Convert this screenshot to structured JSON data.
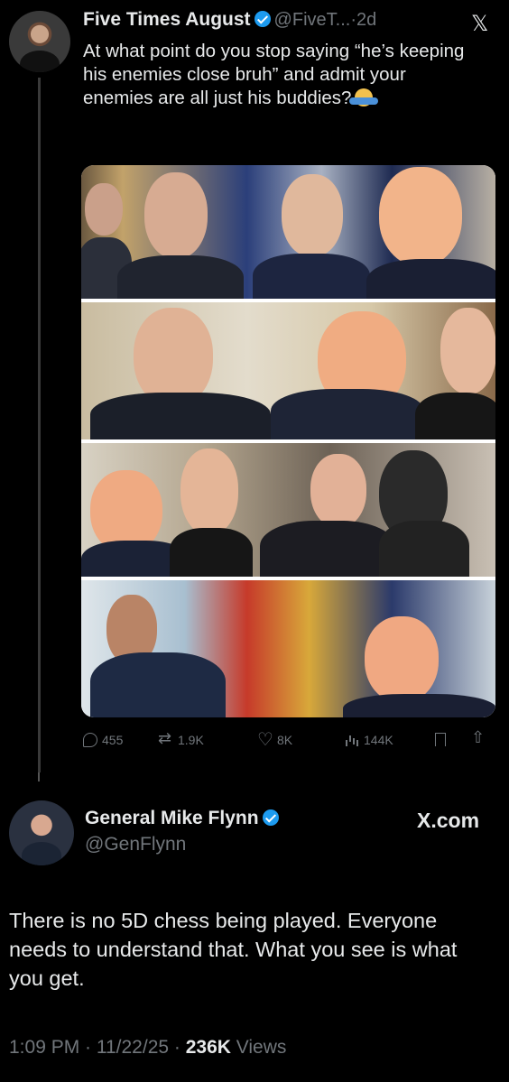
{
  "tweet1": {
    "author_name": "Five Times August",
    "handle": "@FiveT...",
    "age": "·2d",
    "platform_icon": "x-logo",
    "text": "At what point do you stop saying “he’s keeping his enemies close bruh” and admit your enemies are all just his buddies?",
    "emoji": "person-shrugging-icon",
    "photos": [
      "photo-1",
      "photo-2",
      "photo-3",
      "photo-4"
    ],
    "actions": {
      "replies": "455",
      "reposts": "1.9K",
      "likes": "8K",
      "views": "144K"
    }
  },
  "tweet2": {
    "author_name": "General Mike Flynn",
    "handle": "@GenFlynn",
    "source": "X.com",
    "text": "There is no 5D chess being played. Everyone needs to understand that. What you see is what you get.",
    "time": "1:09 PM · 11/22/25 · ",
    "views_count": "236K",
    "views_label": " Views"
  },
  "colors": {
    "background": "#000000",
    "text": "#e7e9ea",
    "muted": "#71767b",
    "verified": "#1d9bf0"
  }
}
